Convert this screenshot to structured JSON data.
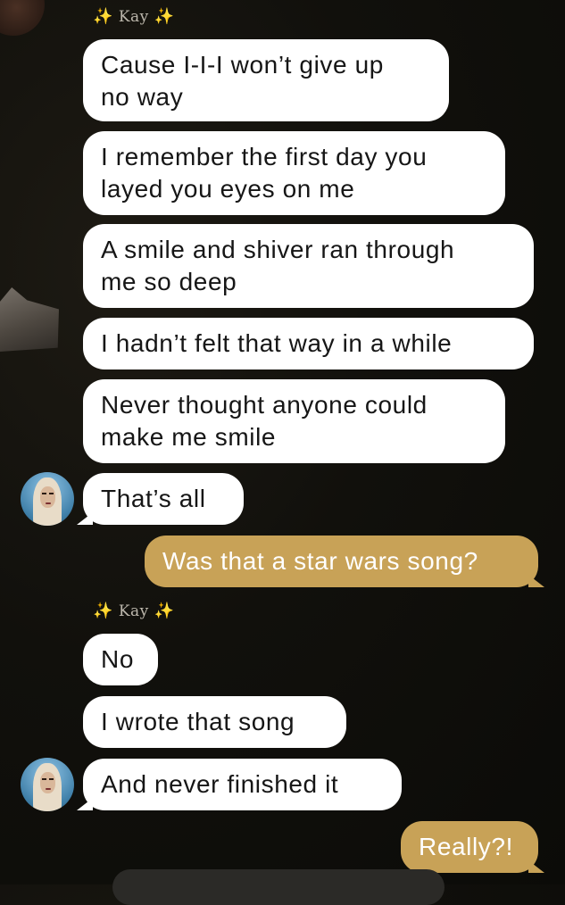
{
  "chat": {
    "sender_1": "Kay",
    "sender_2": "Kay",
    "sparkle": "✨",
    "messages": [
      "Cause I-I-I won’t give up\nno way",
      "I remember the first day you\nlayed you eyes on me",
      "A smile and shiver ran through\nme so deep",
      "I hadn’t felt that way in a while",
      "Never thought anyone could\nmake me smile",
      "That’s all",
      "Was that a star wars song?",
      "No",
      "I wrote that song",
      "And never finished it",
      "Really?!"
    ]
  },
  "colors": {
    "incoming_bubble": "#ffffff",
    "outgoing_bubble": "#c8a257",
    "background": "#11100c"
  }
}
